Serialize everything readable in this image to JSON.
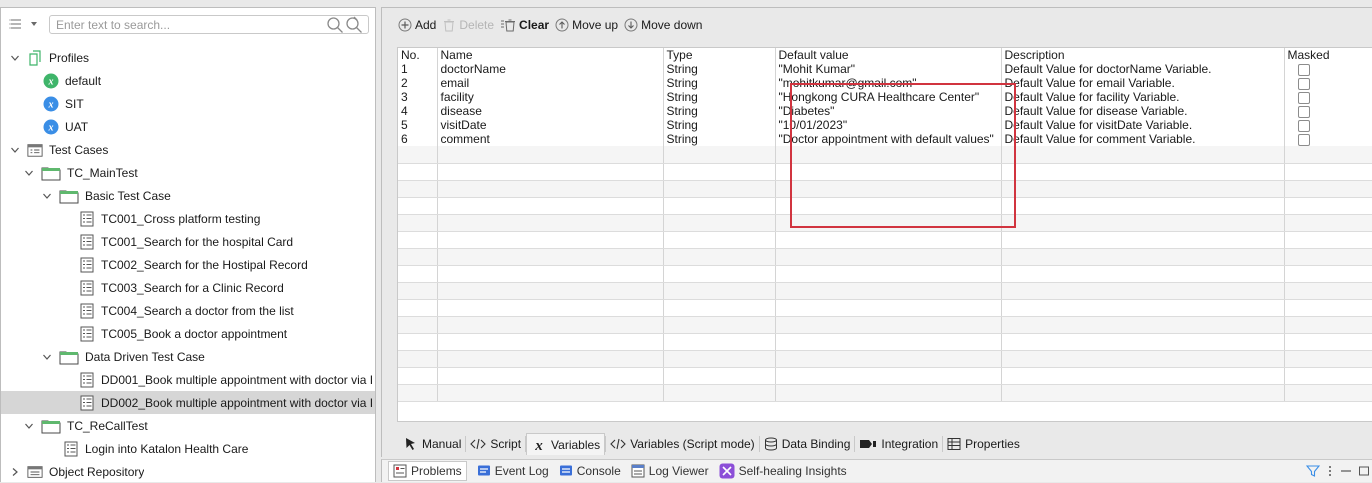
{
  "explorer": {
    "search_placeholder": "Enter text to search...",
    "tree": [
      {
        "label": "Profiles",
        "depth": 0,
        "twisty": "open",
        "icon": "profile-folder-icon"
      },
      {
        "label": "default",
        "depth": 1,
        "twisty": "none",
        "icon": "variable-profile-green-icon"
      },
      {
        "label": "SIT",
        "depth": 1,
        "twisty": "none",
        "icon": "variable-profile-blue-icon"
      },
      {
        "label": "UAT",
        "depth": 1,
        "twisty": "none",
        "icon": "variable-profile-blue-icon"
      },
      {
        "label": "Test Cases",
        "depth": 0,
        "twisty": "open",
        "icon": "test-cases-root-icon"
      },
      {
        "label": "TC_MainTest",
        "depth": 1,
        "twisty": "open",
        "icon": "folder-icon"
      },
      {
        "label": "Basic Test Case",
        "depth": 2,
        "twisty": "open",
        "icon": "folder-icon"
      },
      {
        "label": "TC001_Cross platform testing",
        "depth": 3,
        "twisty": "none",
        "icon": "test-case-icon"
      },
      {
        "label": "TC001_Search for the hospital Card",
        "depth": 3,
        "twisty": "none",
        "icon": "test-case-icon"
      },
      {
        "label": "TC002_Search for the Hostipal Record",
        "depth": 3,
        "twisty": "none",
        "icon": "test-case-icon"
      },
      {
        "label": "TC003_Search for a Clinic Record",
        "depth": 3,
        "twisty": "none",
        "icon": "test-case-icon"
      },
      {
        "label": "TC004_Search a doctor from the list",
        "depth": 3,
        "twisty": "none",
        "icon": "test-case-icon"
      },
      {
        "label": "TC005_Book a doctor appointment",
        "depth": 3,
        "twisty": "none",
        "icon": "test-case-icon"
      },
      {
        "label": "Data Driven Test Case",
        "depth": 2,
        "twisty": "open",
        "icon": "folder-icon"
      },
      {
        "label": "DD001_Book multiple appointment with doctor via I",
        "depth": 3,
        "twisty": "none",
        "icon": "test-case-icon"
      },
      {
        "label": "DD002_Book multiple appointment with doctor via I",
        "depth": 3,
        "twisty": "none",
        "icon": "test-case-icon",
        "selected": true
      },
      {
        "label": "TC_ReCallTest",
        "depth": 1,
        "twisty": "open",
        "icon": "folder-icon"
      },
      {
        "label": "Login into Katalon Health Care",
        "depth": 2,
        "twisty": "none",
        "icon": "test-case-icon"
      },
      {
        "label": "Object Repository",
        "depth": 0,
        "twisty": "closed",
        "icon": "object-repository-icon"
      }
    ]
  },
  "toolbar": {
    "add": "Add",
    "delete": "Delete",
    "clear": "Clear",
    "move_up": "Move up",
    "move_down": "Move down"
  },
  "variables_table": {
    "columns": [
      "No.",
      "Name",
      "Type",
      "Default value",
      "Description",
      "Masked"
    ],
    "rows": [
      {
        "no": "1",
        "name": "doctorName",
        "type": "String",
        "default": "\"Mohit Kumar\"",
        "description": "Default Value for doctorName Variable.",
        "masked": false
      },
      {
        "no": "2",
        "name": "email",
        "type": "String",
        "default": "\"mohitkumar@gmail.com\"",
        "description": "Default Value for email Variable.",
        "masked": false
      },
      {
        "no": "3",
        "name": "facility",
        "type": "String",
        "default": "\"Hongkong CURA Healthcare Center\"",
        "description": "Default Value for facility Variable.",
        "masked": false
      },
      {
        "no": "4",
        "name": "disease",
        "type": "String",
        "default": "\"Diabetes\"",
        "description": "Default Value for disease Variable.",
        "masked": false
      },
      {
        "no": "5",
        "name": "visitDate",
        "type": "String",
        "default": "\"10/01/2023\"",
        "description": "Default Value for visitDate Variable.",
        "masked": false
      },
      {
        "no": "6",
        "name": "comment",
        "type": "String",
        "default": "\"Doctor appointment with default values\"",
        "description": "Default Value for comment Variable.",
        "masked": false
      }
    ]
  },
  "editor_tabs": [
    {
      "label": "Manual",
      "icon": "manual-cursor-icon",
      "active": false
    },
    {
      "label": "Script",
      "icon": "code-brackets-icon",
      "active": false
    },
    {
      "label": "Variables",
      "icon": "variable-x-icon",
      "active": true
    },
    {
      "label": "Variables (Script mode)",
      "icon": "code-brackets-icon",
      "active": false
    },
    {
      "label": "Data Binding",
      "icon": "database-icon",
      "active": false
    },
    {
      "label": "Integration",
      "icon": "integration-icon",
      "active": false
    },
    {
      "label": "Properties",
      "icon": "properties-table-icon",
      "active": false
    }
  ],
  "bottom_tabs": [
    {
      "label": "Problems",
      "icon": "problems-icon",
      "active": true
    },
    {
      "label": "Event Log",
      "icon": "event-log-icon",
      "active": false
    },
    {
      "label": "Console",
      "icon": "console-icon",
      "active": false
    },
    {
      "label": "Log Viewer",
      "icon": "log-viewer-icon",
      "active": false
    },
    {
      "label": "Self-healing Insights",
      "icon": "self-healing-icon",
      "active": false
    }
  ],
  "colors": {
    "highlight_border": "#d1343f",
    "profile_green": "#3fb56a",
    "profile_blue": "#3a8ee6",
    "selected_row": "#d6d6d6"
  }
}
